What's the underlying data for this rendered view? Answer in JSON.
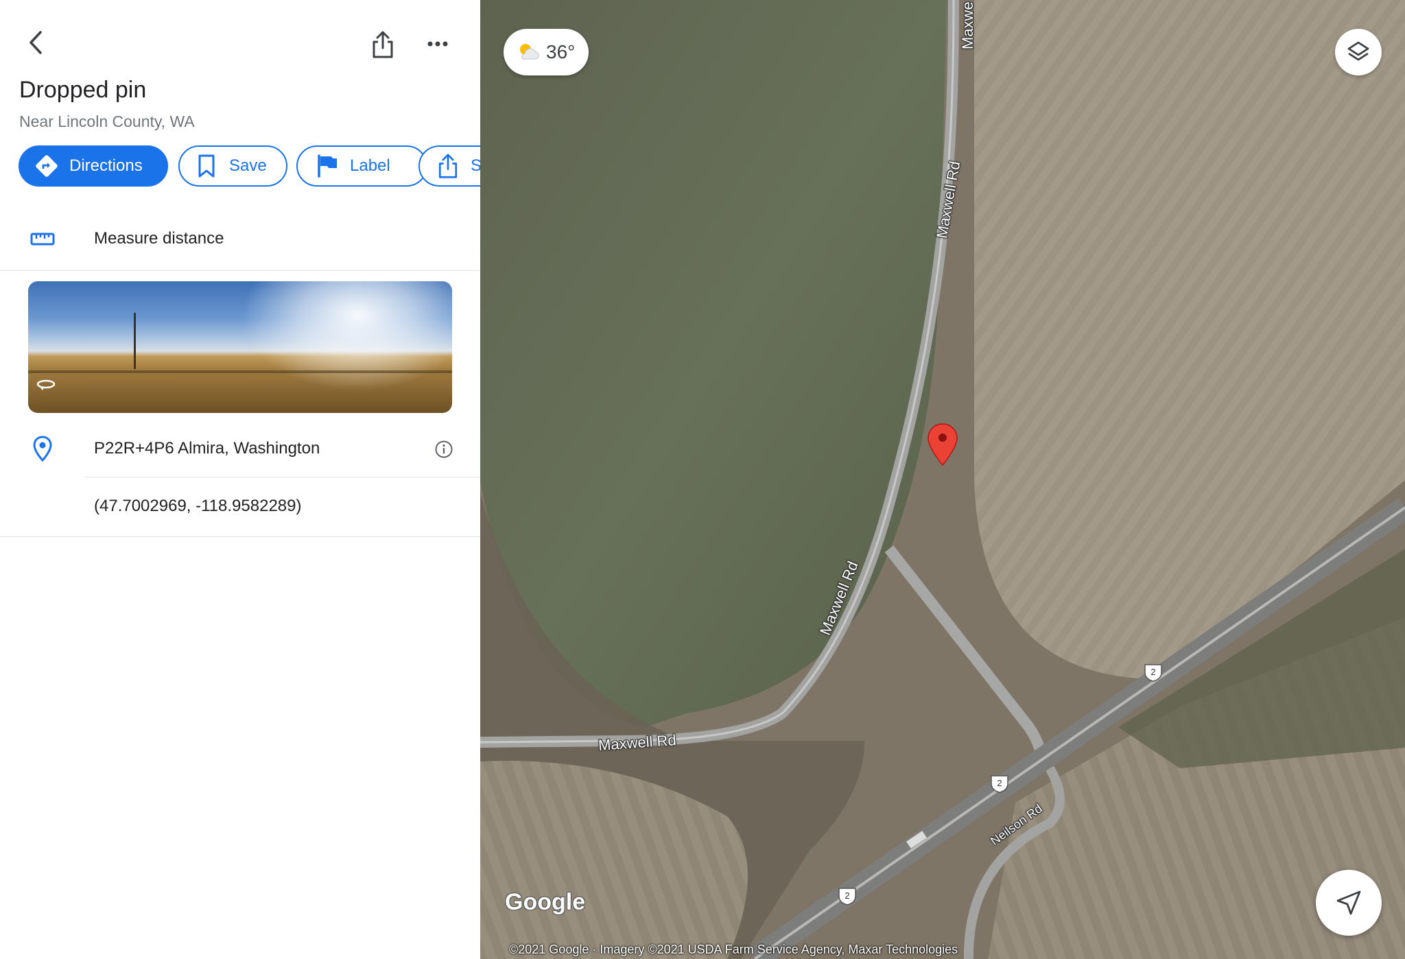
{
  "panel": {
    "title": "Dropped pin",
    "subtitle": "Near Lincoln County, WA",
    "actions": {
      "directions": "Directions",
      "save": "Save",
      "label": "Label",
      "share": "Share"
    },
    "measure_label": "Measure distance",
    "plus_code": "P22R+4P6 Almira, Washington",
    "coordinates": "(47.7002969, -118.9582289)"
  },
  "map": {
    "weather_temp": "36°",
    "roads": {
      "maxwell_1": "Maxwell Rd",
      "maxwell_2": "Maxwell Rd",
      "maxwell_3": "Maxwell Rd",
      "maxwell_4": "Maxwe",
      "neilson": "Neilson Rd"
    },
    "highway_number": "2",
    "logo": "Google",
    "attribution": "©2021 Google · Imagery ©2021 USDA Farm Service Agency, Maxar Technologies"
  },
  "colors": {
    "accent": "#1a73e8",
    "pin": "#ea4335"
  },
  "icons": [
    "back-arrow-icon",
    "share-icon",
    "more-icon",
    "directions-icon",
    "bookmark-icon",
    "flag-icon",
    "ruler-icon",
    "location-pin-icon",
    "info-icon",
    "weather-icon",
    "layers-icon",
    "navigation-arrow-icon",
    "panorama-icon"
  ]
}
